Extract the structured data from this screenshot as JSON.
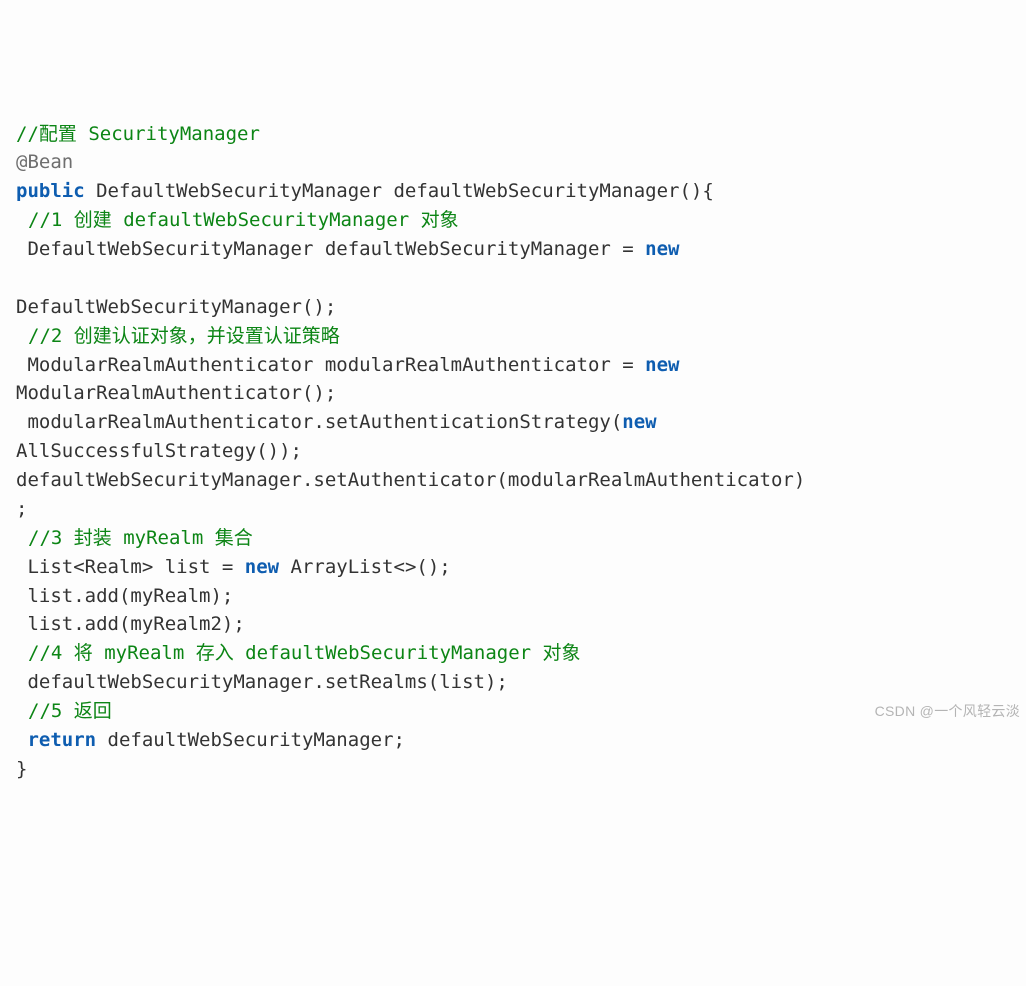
{
  "code": {
    "c0_a": "//配置 SecurityManager",
    "l1": "@Bean",
    "l2_a": "public",
    "l2_b": " DefaultWebSecurityManager defaultWebSecurityManager(){",
    "c3": "//1 创建 defaultWebSecurityManager 对象",
    "l4_a": " DefaultWebSecurityManager defaultWebSecurityManager = ",
    "l4_b": "new",
    "l5": "",
    "l6": "DefaultWebSecurityManager();",
    "c7": "//2 创建认证对象，并设置认证策略",
    "l8_a": " ModularRealmAuthenticator modularRealmAuthenticator = ",
    "l8_b": "new",
    "l9": "ModularRealmAuthenticator();",
    "l10_a": " modularRealmAuthenticator.setAuthenticationStrategy(",
    "l10_b": "new",
    "l11": "AllSuccessfulStrategy());",
    "l12": "defaultWebSecurityManager.setAuthenticator(modularRealmAuthenticator)",
    "l13": ";",
    "c14": "//3 封装 myRealm 集合",
    "l15_a": " List<Realm> list = ",
    "l15_b": "new",
    "l15_c": " ArrayList<>();",
    "l16": " list.add(myRealm);",
    "l17": " list.add(myRealm2);",
    "c18": "//4 将 myRealm 存入 defaultWebSecurityManager 对象",
    "l19": " defaultWebSecurityManager.setRealms(list);",
    "c20": "//5 返回",
    "l21_a": "return",
    "l21_b": " defaultWebSecurityManager;",
    "l22": "}"
  },
  "watermark": "CSDN @一个风轻云淡"
}
